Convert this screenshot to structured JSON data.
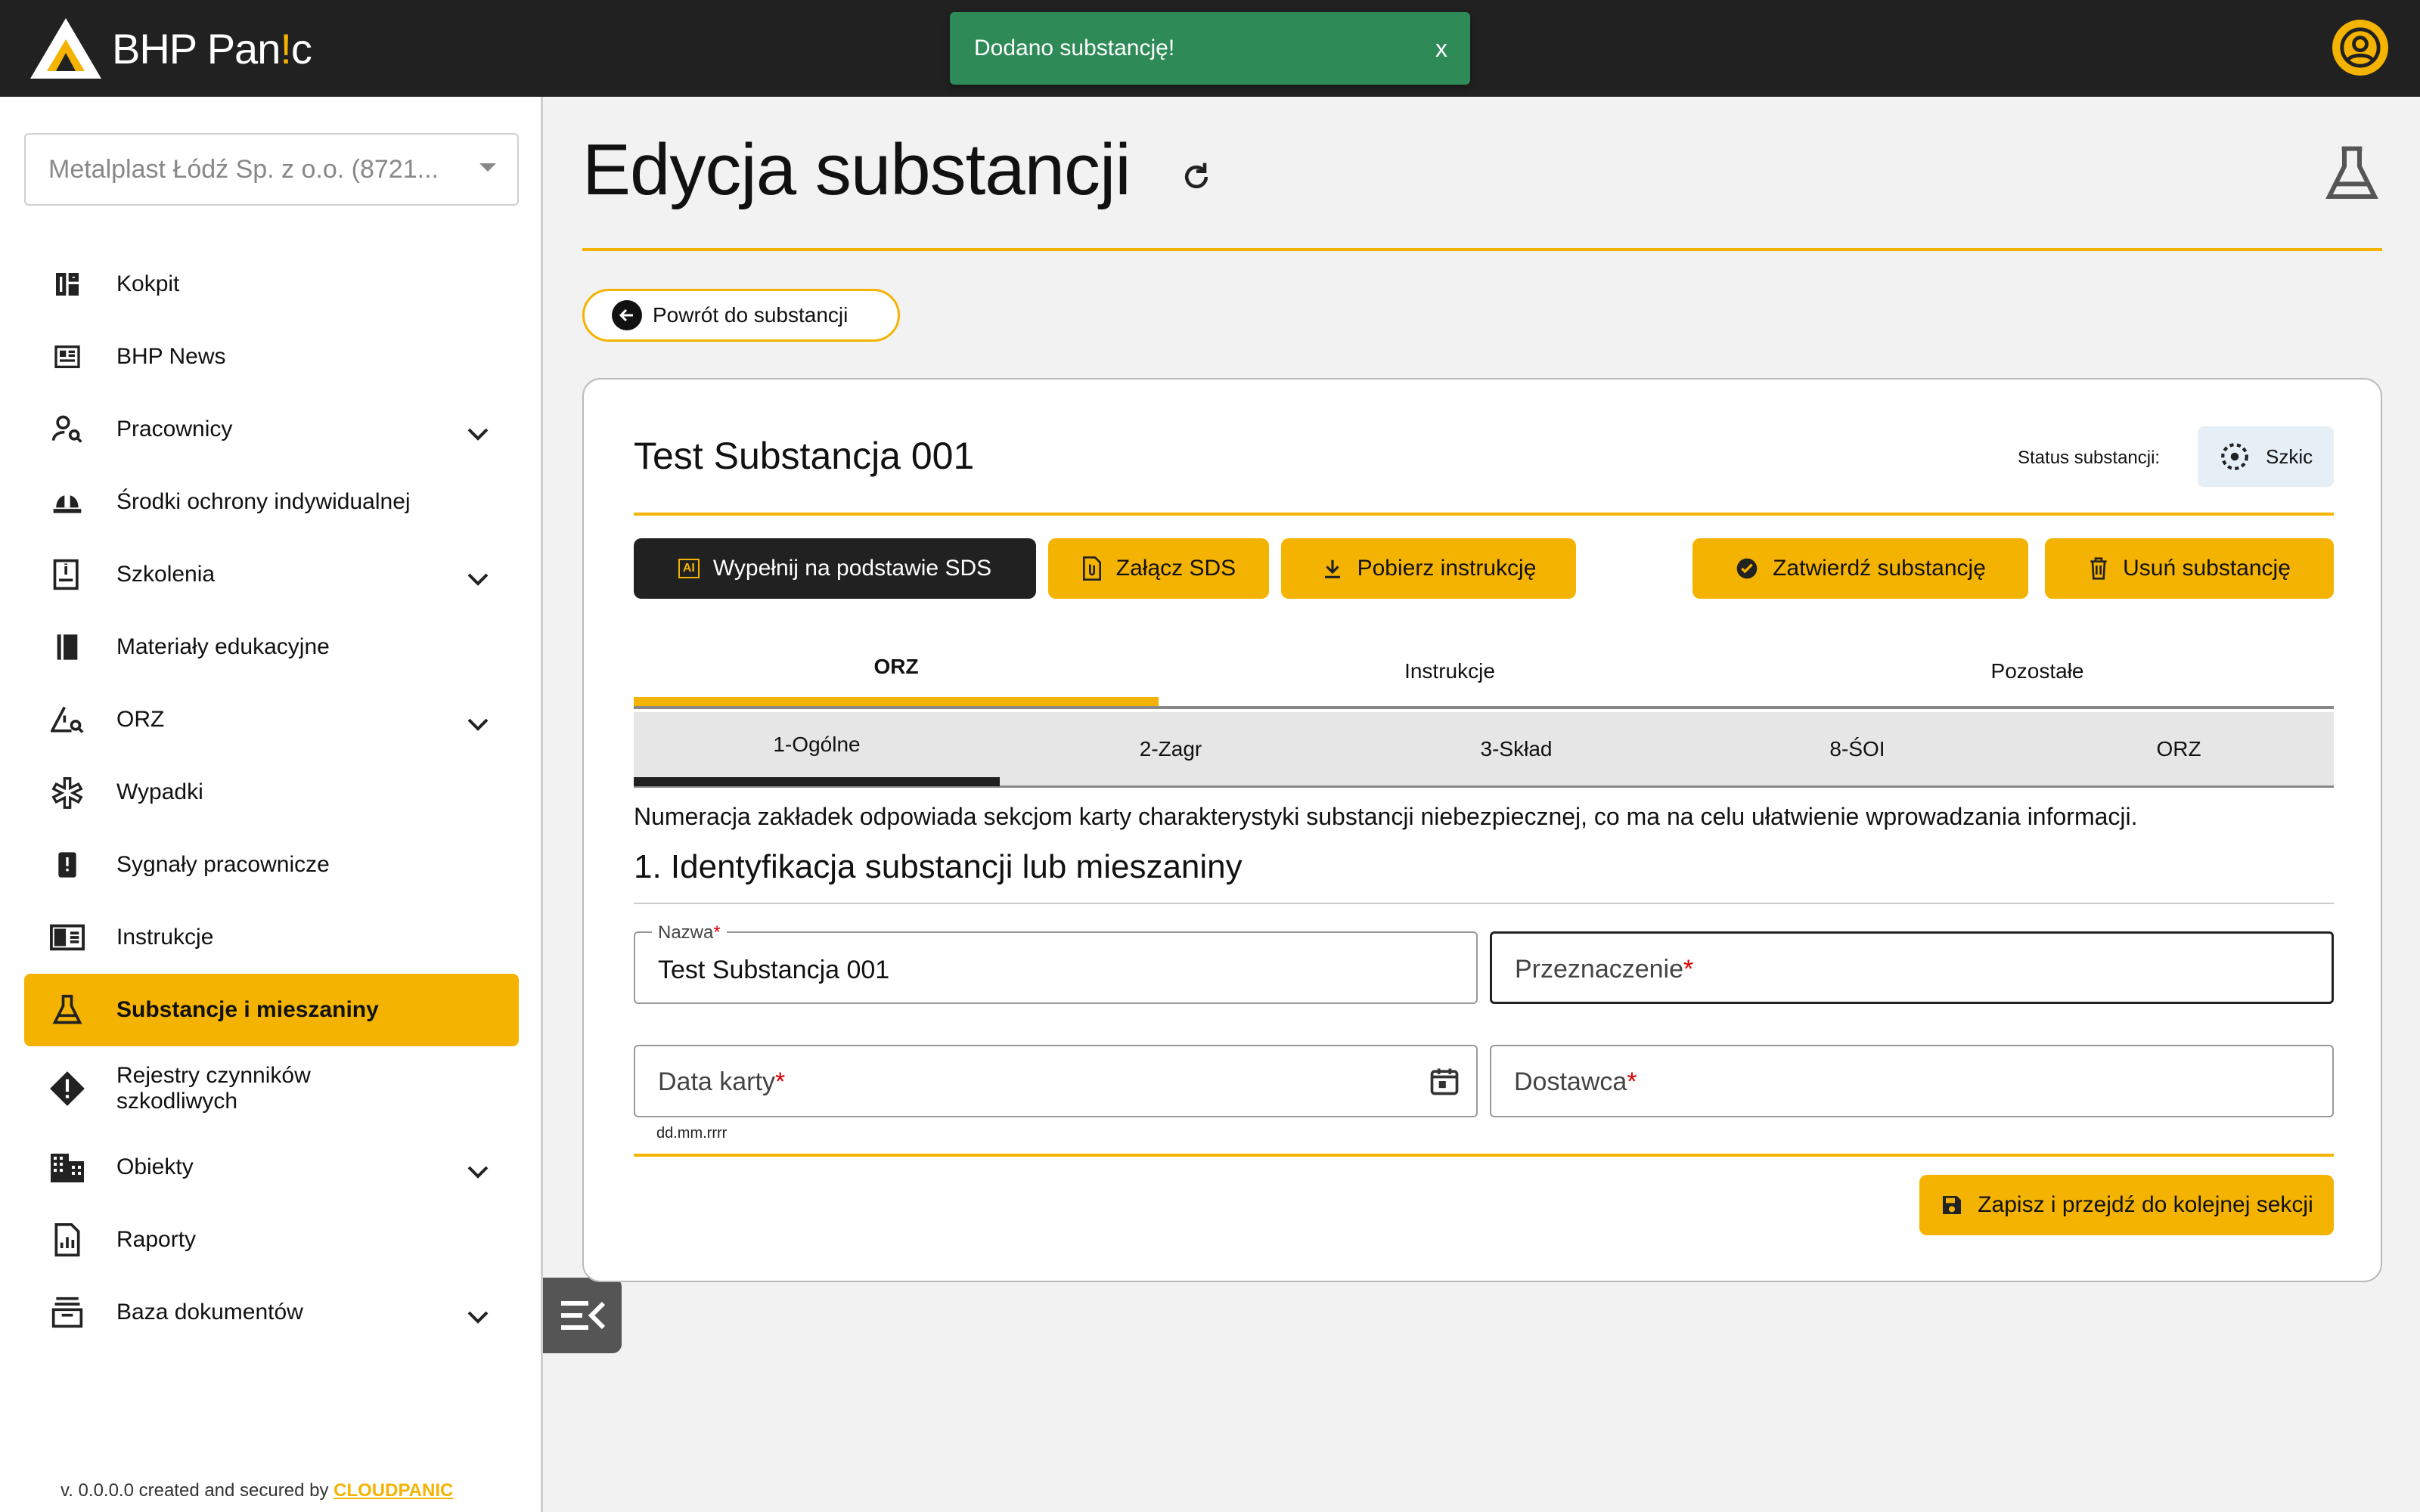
{
  "topbar": {
    "logo_text_main": "BHP Pan",
    "logo_text_accent": "!",
    "logo_text_end": "c",
    "account_icon": "account-circle-icon"
  },
  "toast": {
    "message": "Dodano substancję!",
    "close_label": "x",
    "color": "#2e8b57"
  },
  "sidebar": {
    "company_select": "Metalplast Łódź Sp. z o.o. (8721...",
    "items": [
      {
        "label": "Kokpit",
        "icon": "dashboard-icon",
        "expandable": false
      },
      {
        "label": "BHP News",
        "icon": "newspaper-icon",
        "expandable": false
      },
      {
        "label": "Pracownicy",
        "icon": "person-search-icon",
        "expandable": true
      },
      {
        "label": "Środki ochrony indywidualnej",
        "icon": "hard-hat-icon",
        "expandable": false
      },
      {
        "label": "Szkolenia",
        "icon": "training-book-icon",
        "expandable": true
      },
      {
        "label": "Materiały edukacyjne",
        "icon": "book-icon",
        "expandable": false
      },
      {
        "label": "ORZ",
        "icon": "warning-search-icon",
        "expandable": true
      },
      {
        "label": "Wypadki",
        "icon": "medical-star-icon",
        "expandable": false
      },
      {
        "label": "Sygnały pracownicze",
        "icon": "report-icon",
        "expandable": false
      },
      {
        "label": "Instrukcje",
        "icon": "instructions-icon",
        "expandable": false
      },
      {
        "label": "Substancje i mieszaniny",
        "icon": "flask-icon",
        "expandable": false,
        "active": true
      },
      {
        "label": "Rejestry czynników szkodliwych",
        "icon": "alert-diamond-icon",
        "expandable": false
      },
      {
        "label": "Obiekty",
        "icon": "building-icon",
        "expandable": true
      },
      {
        "label": "Raporty",
        "icon": "report-chart-icon",
        "expandable": false
      },
      {
        "label": "Baza dokumentów",
        "icon": "archive-icon",
        "expandable": true
      }
    ],
    "footer_text": "v. 0.0.0.0 created and secured by ",
    "footer_brand": "CLOUDPANIC"
  },
  "main": {
    "title": "Edycja substancji",
    "back_label": "Powrót do substancji",
    "card": {
      "substance_name": "Test Substancja 001",
      "status_label": "Status substancji:",
      "status_value": "Szkic",
      "actions": {
        "fill_sds": "Wypełnij na podstawie SDS",
        "ai_badge": "AI",
        "attach_sds": "Załącz SDS",
        "download_instr": "Pobierz instrukcję",
        "approve": "Zatwierdź substancję",
        "delete": "Usuń substancję"
      },
      "tabs_main": [
        "ORZ",
        "Instrukcje",
        "Pozostałe"
      ],
      "tabs_sub": [
        "1-Ogólne",
        "2-Zagr",
        "3-Skład",
        "8-ŚOI",
        "ORZ"
      ],
      "info": "Numeracja zakładek odpowiada sekcjom karty charakterystyki substancji niebezpiecznej, co ma na celu ułatwienie wprowadzania informacji.",
      "section_title": "1. Identyfikacja substancji lub mieszaniny",
      "fields": {
        "name_label": "Nazwa",
        "name_value": "Test Substancja 001",
        "purpose_label": "Przeznaczenie",
        "date_label": "Data karty",
        "date_hint": "dd.mm.rrrr",
        "supplier_label": "Dostawca",
        "required_mark": "*"
      },
      "save_label": "Zapisz i przejdź do kolejnej sekcji"
    }
  },
  "colors": {
    "accent": "#f5b301",
    "topbar": "#212121",
    "status_bg": "#e6eef6"
  }
}
